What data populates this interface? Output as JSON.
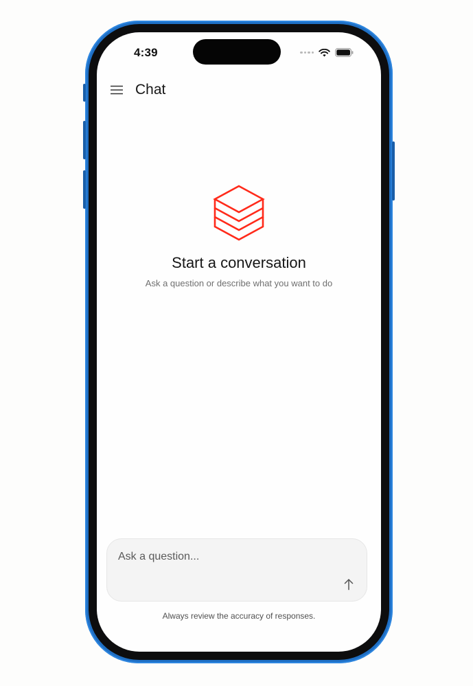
{
  "status_bar": {
    "time": "4:39",
    "icons": [
      "signal-dots-icon",
      "wifi-icon",
      "battery-icon"
    ]
  },
  "header": {
    "menu_icon": "hamburger-menu-icon",
    "title": "Chat"
  },
  "empty_state": {
    "logo_icon": "stacked-layers-logo-icon",
    "title": "Start a conversation",
    "subtitle": "Ask a question or describe what you want to do"
  },
  "composer": {
    "placeholder": "Ask a question...",
    "value": "",
    "send_icon": "arrow-up-icon"
  },
  "disclaimer": "Always review the accuracy of responses.",
  "colors": {
    "accent": "#ff2a1a",
    "frame": "#1f6fc4",
    "background": "#fefefe"
  }
}
